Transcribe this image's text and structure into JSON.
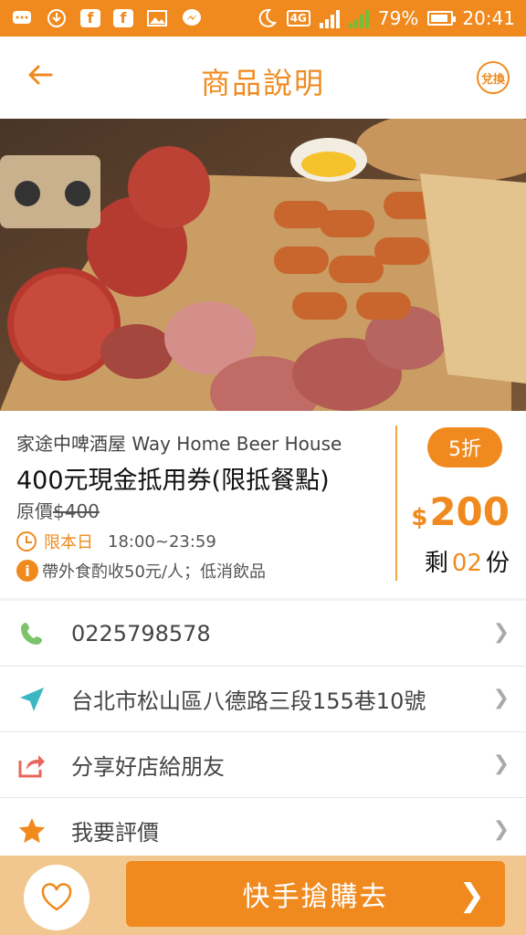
{
  "status_bar": {
    "notification_icons": [
      "message-icon",
      "download-icon",
      "facebook-icon",
      "facebook-icon",
      "image-icon",
      "messenger-icon"
    ],
    "network": "4G",
    "battery": "79%",
    "time": "20:41"
  },
  "header": {
    "title": "商品說明",
    "exchange_label": "兌換"
  },
  "deal": {
    "store_name": "家途中啤酒屋 Way Home Beer House",
    "title": "400元現金抵用券(限抵餐點)",
    "original_label": "原價",
    "original_price": "$400",
    "time_label": "限本日",
    "time_range": "18:00~23:59",
    "note": "帶外食酌收50元/人；低消飲品",
    "discount": "5折",
    "currency": "$",
    "price": "200",
    "remaining_prefix": "剩",
    "remaining": "02",
    "remaining_suffix": "份"
  },
  "rows": [
    {
      "label": "0225798578",
      "icon": "phone-icon"
    },
    {
      "label": "台北市松山區八德路三段155巷10號",
      "icon": "location-arrow-icon"
    },
    {
      "label": "分享好店給朋友",
      "icon": "share-icon"
    },
    {
      "label": "我要評價",
      "icon": "star-icon"
    }
  ],
  "bottom": {
    "buy_label": "快手搶購去"
  },
  "colors": {
    "accent": "#f08a1e",
    "phone": "#7cc36b",
    "location": "#3bb7c4",
    "share": "#e8675a",
    "star": "#f08a1e"
  }
}
